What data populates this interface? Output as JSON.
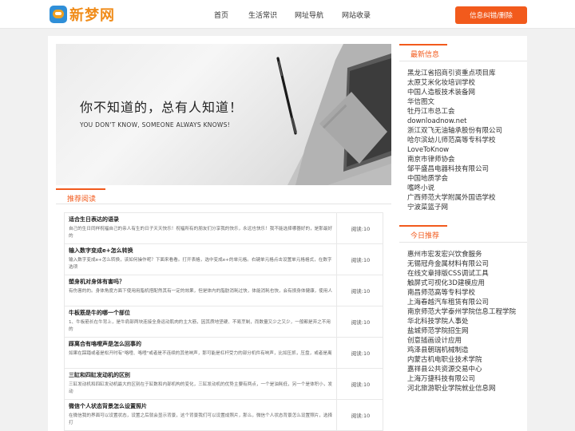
{
  "header": {
    "logo_text": "新梦网",
    "nav": [
      "首页",
      "生活常识",
      "网址导航",
      "网站收录"
    ],
    "report_button": "信息纠错/删除"
  },
  "banner": {
    "title": "你不知道的，总有人知道！",
    "subtitle": "YOU DON'T KNOW, SOMEONE ALWAYS KNOWS!"
  },
  "recommend": {
    "heading": "推荐阅读",
    "articles": [
      {
        "title": "适合生日表达的语录",
        "summary": "自己的生日同样祝福自己的亲人有生的日子天天快乐！祝福所有的朋友们分享我的快乐，永远也快乐！我不能选择哪器好的，是那最好的",
        "views": "阅读:10"
      },
      {
        "title": "输入数字变成e+怎么转换",
        "summary": "输入数字变成e+怎么转换，该如何操作呢？下面来看看。打开表格，选中变成e+的单元格。右键单元格点击设置单元格格式，在数字选项",
        "views": "阅读:10"
      },
      {
        "title": "塑身机对身体有害吗？",
        "summary": "有伤害的的。身体角度方面下使用用脂机搭配然其有一定的效果，但是体内的脂肪消耗过快，体能消耗也快，会有损身体健康，使用人",
        "views": "阅读:10"
      },
      {
        "title": "牛板筋是牛的哪一个部位",
        "summary": "1、牛板筋长在牛背上，是牛肩部两块连接全身运动肌肉的主大筋，因其质地坚硬、不易烹制，而数量又少之又少，一般都是弃之不用的",
        "views": "阅读:10"
      },
      {
        "title": "踩离合有咯噔声是怎么回事的",
        "summary": "如果在踩踏或者是松开时有\"咯噔、咯噔\"或者是不连续的其他响声，那可能是杠杆受力的部分机件有响声，比如压抓，压盘，或者是离",
        "views": "阅读:10"
      },
      {
        "title": "三缸和四缸发动机的区别",
        "summary": "三缸发动机和四缸发动机最大的区别在于缸数和内部机构的变化，三缸发动机的优势主要有两点，一个是油耗低，另一个是体积小，发动",
        "views": "阅读:10"
      },
      {
        "title": "微信个人状态背景怎么设置照片",
        "summary": "在微信我的界面可以设置状态，设置之后就会显示背景，这个背景我们可以设置成照片，那么，微信个人状态背景怎么设置照片，选择打",
        "views": "阅读:10"
      }
    ]
  },
  "latest": {
    "heading": "最新信息",
    "items": [
      "黑龙江省招商引资重点项目库",
      "太原艾米化妆培训学校",
      "中国人造板技术装备网",
      "华信图文",
      "牡丹江市总工会",
      "downloadnow.net",
      "浙江双飞无油轴承股份有限公司",
      "哈尔滨幼儿师范高等专科学校",
      "LoveToKnow",
      "南京市律师协会",
      "邹平盛昌电器科技有限公司",
      "中国地质学会",
      "嗜咚小说",
      "广西师范大学附属外国语学校",
      "宁波菜篮子网"
    ]
  },
  "today": {
    "heading": "今日推荐",
    "items": [
      "惠州市宏发宏兴饮食服务",
      "无锡冠舟金属材料有限公司",
      "在线文章排版CSS调试工具",
      "触屏式可视化3D建模应用",
      "南昌师范高等专科学校",
      "上海春越汽车租赁有限公司",
      "南京师范大学泰州学院信息工程学院",
      "华北科技学院人事处",
      "盐城师范学院招生网",
      "创意插画设计应用",
      "鸡泽县朝瑞机械制造",
      "内蒙古机电职业技术学院",
      "嘉祥县公共资源交易中心",
      "上海万捷科技有限公司",
      "河北旅游职业学院就业信息网"
    ]
  }
}
